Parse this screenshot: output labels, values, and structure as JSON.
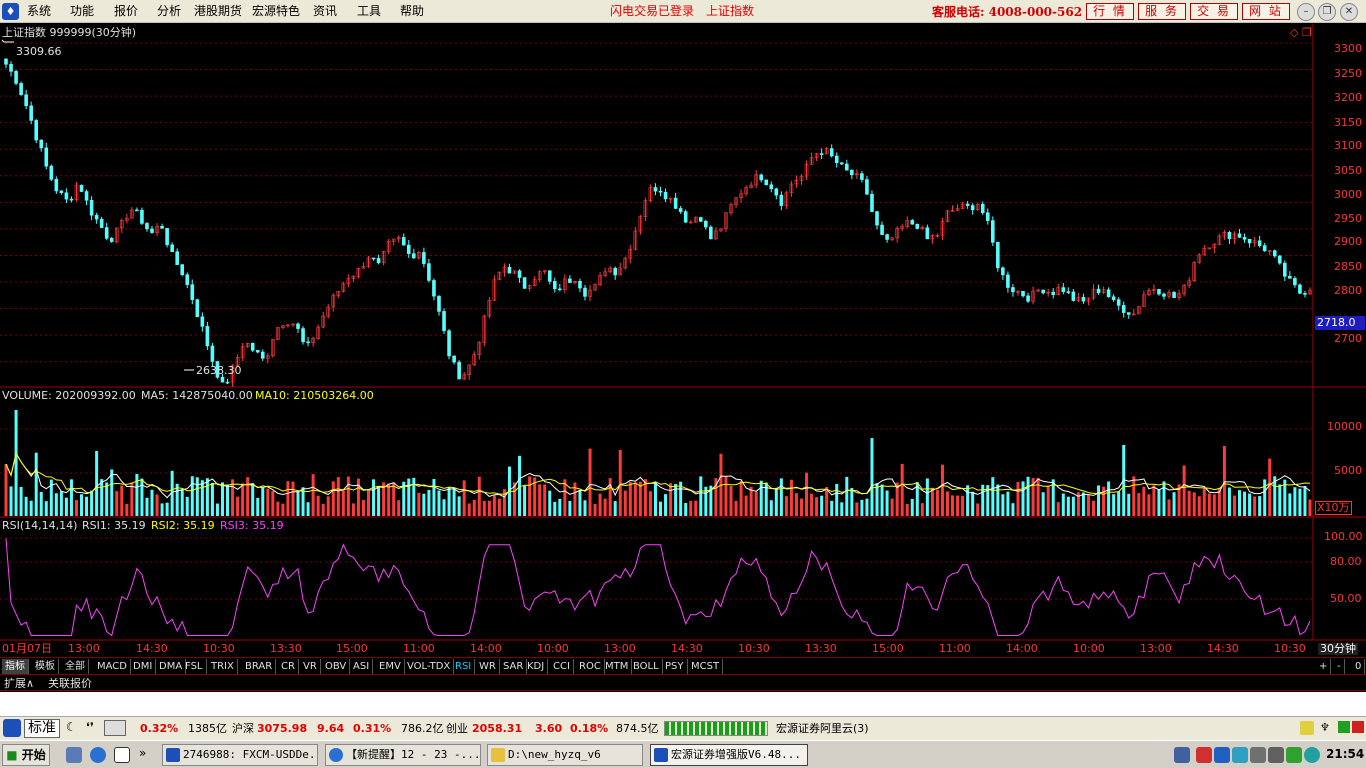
{
  "menu": {
    "logo": "♦",
    "items": [
      "系统",
      "功能",
      "报价",
      "分析",
      "港股期货",
      "宏源特色",
      "资讯",
      "工具",
      "帮助"
    ],
    "alert_login": "闪电交易已登录",
    "alert_index": "上证指数",
    "hotline": "客服电话: 4008-000-562",
    "buttons": [
      "行 情",
      "服 务",
      "交 易",
      "网 站"
    ]
  },
  "price_panel": {
    "title": "上证指数 999999(30分钟)",
    "high_label": "3309.66",
    "low_label": "2638.30",
    "current_tag": "2718.0",
    "y_ticks": [
      "3300",
      "3250",
      "3200",
      "3150",
      "3100",
      "3050",
      "3000",
      "2950",
      "2900",
      "2850",
      "2800",
      "2700"
    ]
  },
  "volume_panel": {
    "label_vol": "VOLUME: 202009392.00",
    "label_ma5": "MA5: 142875040.00",
    "label_ma10": "MA10: 210503264.00",
    "y_ticks": [
      "10000",
      "5000"
    ],
    "unit": "X10万"
  },
  "rsi_panel": {
    "label_name": "RSI(14,14,14)",
    "label_rsi1": "RSI1: 35.19",
    "label_rsi2": "RSI2: 35.19",
    "label_rsi3": "RSI3: 35.19",
    "y_ticks": [
      "100.00",
      "80.00",
      "50.00"
    ]
  },
  "time_axis": {
    "labels": [
      "01月07日",
      "13:00",
      "14:30",
      "10:30",
      "13:30",
      "15:00",
      "11:00",
      "14:00",
      "10:00",
      "13:00",
      "14:30",
      "10:30",
      "13:30",
      "15:00",
      "11:00",
      "14:00",
      "10:00",
      "13:00",
      "14:30",
      "10:30"
    ],
    "period": "30分钟"
  },
  "indicator_tabs": [
    "指标",
    "模板",
    "全部",
    "MACD",
    "DMI",
    "DMA",
    "FSL",
    "TRIX",
    "BRAR",
    "CR",
    "VR",
    "OBV",
    "ASI",
    "EMV",
    "VOL-TDX",
    "RSI",
    "WR",
    "SAR",
    "KDJ",
    "CCI",
    "ROC",
    "MTM",
    "BOLL",
    "PSY",
    "MCST"
  ],
  "tab_controls": [
    "+",
    "-",
    "0"
  ],
  "extra_tabs": [
    "扩展∧",
    "关联报价"
  ],
  "status": {
    "mode": "标准",
    "sh_pct": "0.32%",
    "sh_amount": "1385亿",
    "hs_label": "沪深",
    "hs_value": "3075.98",
    "hs_change": "9.64",
    "hs_pct": "0.31%",
    "hs_amount": "786.2亿",
    "cy_label": "创业",
    "cy_value": "2058.31",
    "cy_change": "3.60",
    "cy_pct": "0.18%",
    "cy_amount": "874.5亿",
    "server": "宏源证券阿里云(3)"
  },
  "taskbar": {
    "start": "开始",
    "tasks": [
      "2746988: FXCM-USDDe...",
      "【新提醒】12 - 23 -...",
      "D:\\new_hyzq_v6",
      "宏源证券增强版V6.48..."
    ],
    "clock": "21:54"
  },
  "colors": {
    "up": "#ff3a3a",
    "down": "#54ffff",
    "ma5": "#ffffff",
    "ma10": "#ffff00",
    "rsi": "#ff40ff",
    "grid": "#7a0000"
  },
  "chart_data": {
    "type": "candlestick",
    "symbol": "上证指数 999999",
    "period": "30分钟",
    "close_path": [
      3260,
      3230,
      3180,
      3120,
      3060,
      3020,
      3000,
      3040,
      2990,
      2960,
      2930,
      2950,
      2990,
      2970,
      2940,
      2960,
      2900,
      2870,
      2820,
      2760,
      2700,
      2650,
      2690,
      2740,
      2720,
      2700,
      2760,
      2780,
      2770,
      2720,
      2760,
      2800,
      2830,
      2860,
      2870,
      2900,
      2880,
      2920,
      2930,
      2900,
      2910,
      2850,
      2780,
      2700,
      2670,
      2700,
      2760,
      2840,
      2880,
      2870,
      2840,
      2860,
      2870,
      2830,
      2850,
      2860,
      2830,
      2840,
      2880,
      2870,
      2900,
      2960,
      3020,
      3030,
      3010,
      2990,
      2960,
      2980,
      2930,
      2950,
      2990,
      3020,
      3040,
      3050,
      3030,
      3000,
      3040,
      3050,
      3090,
      3100,
      3080,
      3060,
      3050,
      3030,
      2960,
      2920,
      2940,
      2960,
      2960,
      2930,
      2940,
      2980,
      2990,
      2990,
      3000,
      2950,
      2870,
      2840,
      2830,
      2820,
      2840,
      2830,
      2840,
      2820,
      2810,
      2830,
      2840,
      2810,
      2800,
      2790,
      2830,
      2840,
      2830,
      2820,
      2840,
      2900,
      2920,
      2930,
      2940,
      2940,
      2930,
      2920,
      2910,
      2880,
      2850,
      2830,
      2840
    ],
    "high_label": 3309.66,
    "low_label": 2638.3,
    "ylim": [
      2660,
      3330
    ]
  }
}
